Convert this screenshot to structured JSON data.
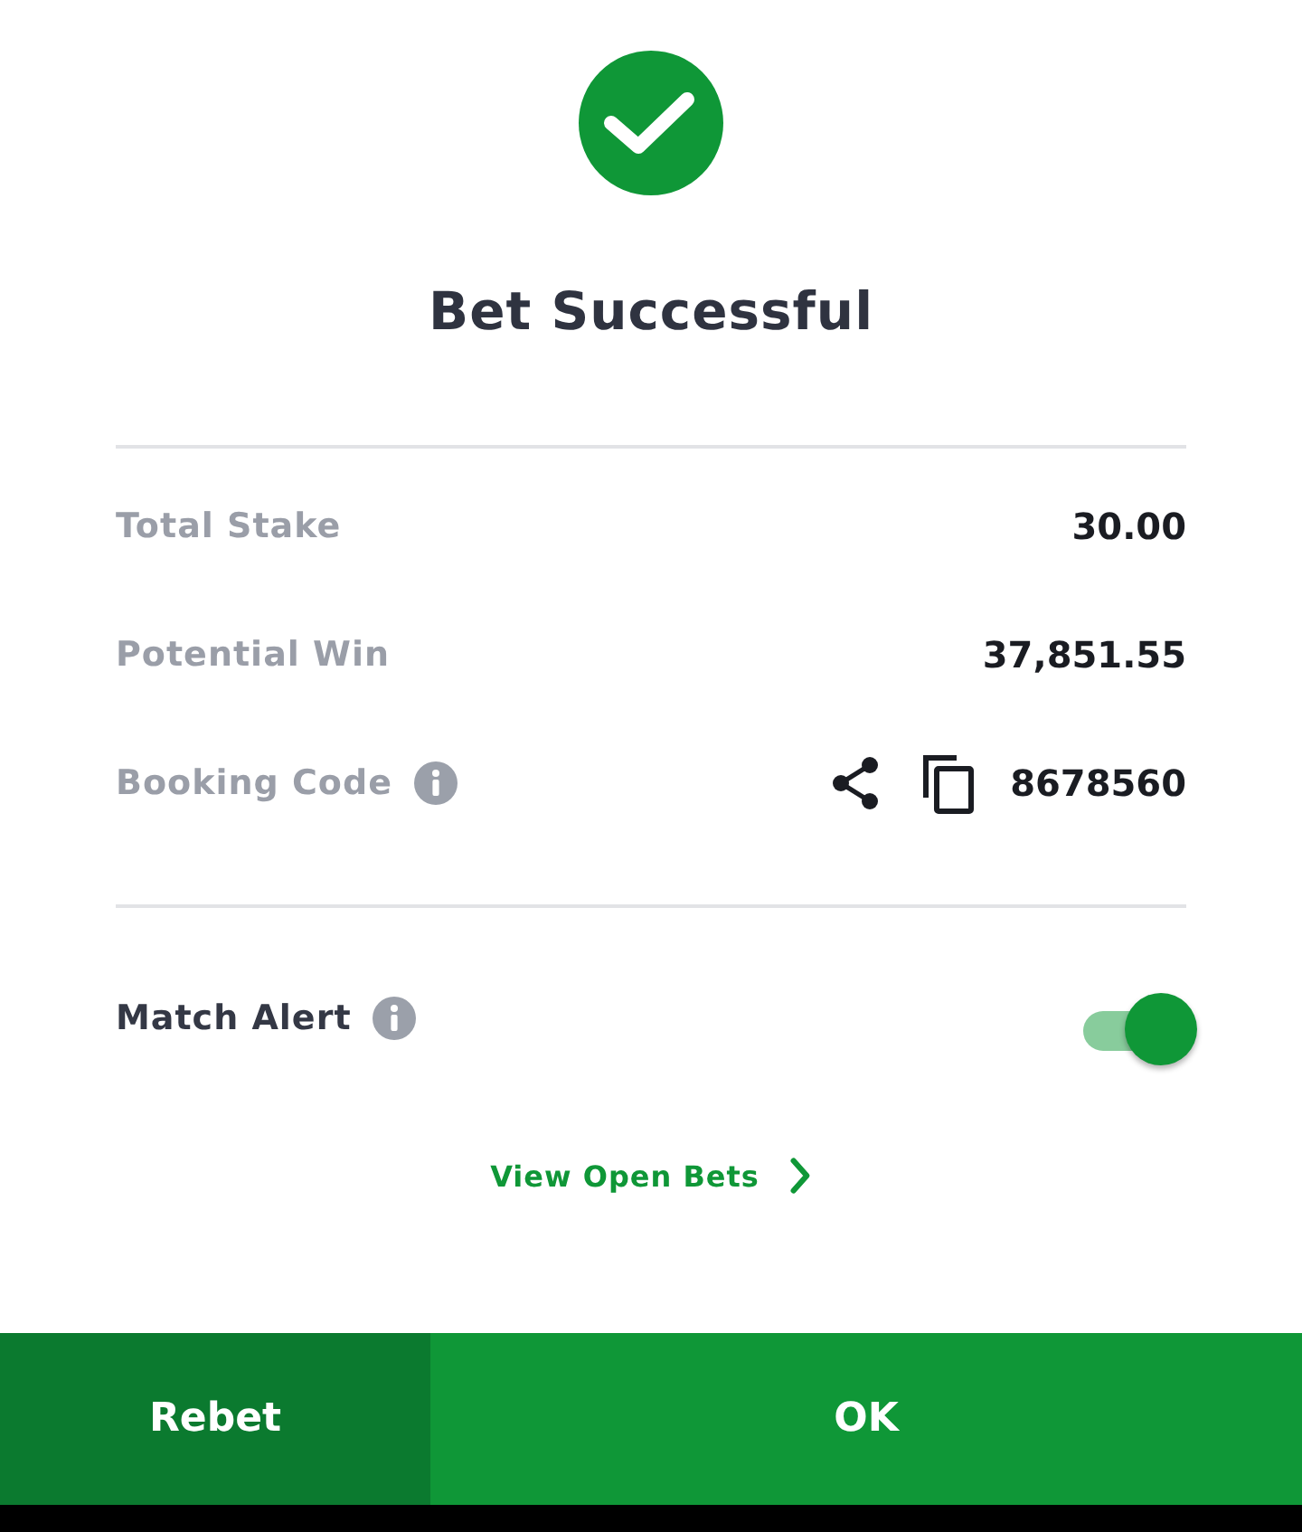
{
  "header": {
    "title": "Bet Successful"
  },
  "details": [
    {
      "kind": "amount",
      "label": "Total Stake",
      "value": "30.00"
    },
    {
      "kind": "amount",
      "label": "Potential Win",
      "value": "37,851.55"
    },
    {
      "kind": "code",
      "label": "Booking Code",
      "info": true,
      "value": "8678560"
    }
  ],
  "match_alert": {
    "label": "Match Alert",
    "info": true,
    "on": true
  },
  "link": {
    "label": "View Open Bets"
  },
  "buttons": [
    {
      "kind": "secondary",
      "label": "Rebet"
    },
    {
      "kind": "primary",
      "label": "OK"
    }
  ]
}
